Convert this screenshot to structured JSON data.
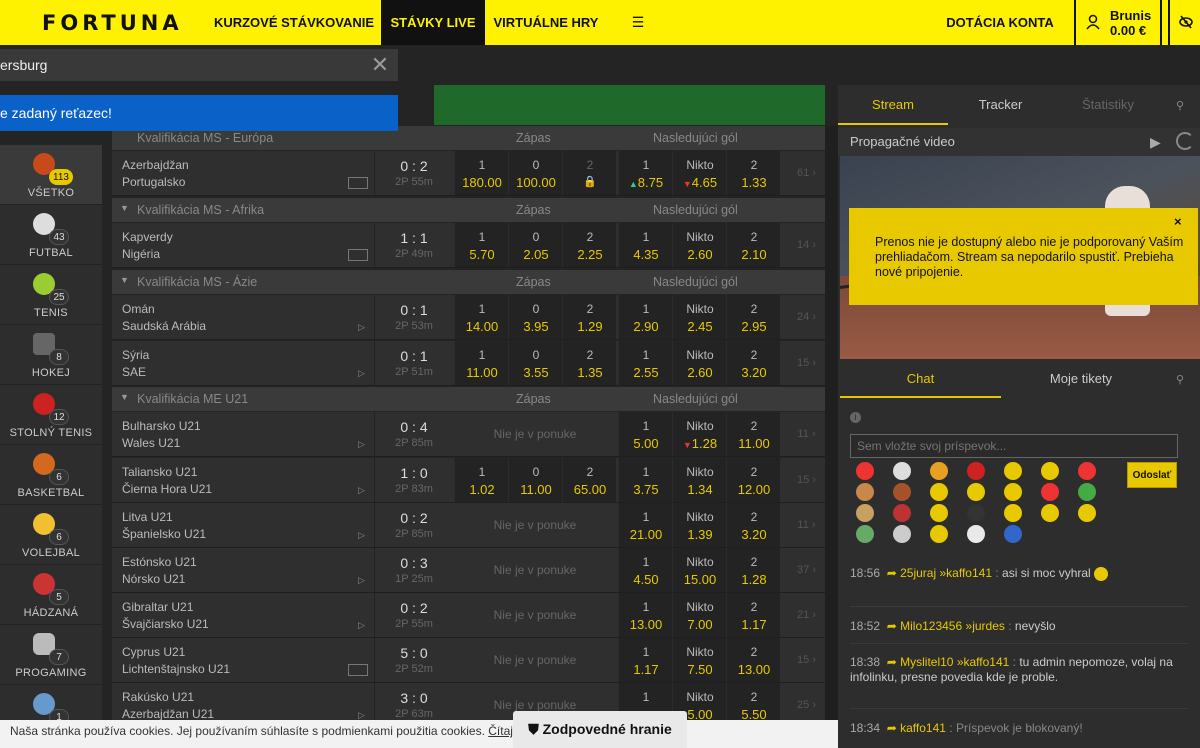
{
  "header": {
    "logo": "FORTUNA",
    "nav": [
      "KURZOVÉ STÁVKOVANIE",
      "STÁVKY LIVE",
      "VIRTUÁLNE HRY"
    ],
    "deposit": "DOTÁCIA KONTA",
    "username": "Brunis",
    "balance": "0.00 €"
  },
  "search": {
    "value": "ersburg",
    "message": "e zadaný reťazec!"
  },
  "sidebar": {
    "items": [
      {
        "label": "VŠETKO",
        "count": "113",
        "color": "#c84a1a"
      },
      {
        "label": "FUTBAL",
        "count": "43",
        "color": "#dddddd"
      },
      {
        "label": "TENIS",
        "count": "25",
        "color": "#9acd32"
      },
      {
        "label": "HOKEJ",
        "count": "8",
        "color": "#666666"
      },
      {
        "label": "STOLNÝ TENIS",
        "count": "12",
        "color": "#cc2222"
      },
      {
        "label": "BASKETBAL",
        "count": "6",
        "color": "#d2691e"
      },
      {
        "label": "VOLEJBAL",
        "count": "6",
        "color": "#f0c030"
      },
      {
        "label": "HÁDZANÁ",
        "count": "5",
        "color": "#cc3333"
      },
      {
        "label": "PROGAMING",
        "count": "7",
        "color": "#bbbbbb"
      },
      {
        "label": "",
        "count": "1",
        "color": "#6699cc"
      }
    ]
  },
  "main": {
    "partial_group": "Kvalifikácia MS - Európa",
    "col_zapas": "Zápas",
    "col_gol": "Nasledujúci gól",
    "na_text": "Nie je v ponuke",
    "groups": [
      {
        "name": "Kvalifikácia MS - Afrika"
      },
      {
        "name": "Kvalifikácia MS - Ázie"
      },
      {
        "name": "Kvalifikácia ME U21"
      }
    ],
    "rows": [
      {
        "t1": "Azerbajdžan",
        "t2": "Portugalsko",
        "score": "0 : 2",
        "time": "2P 55m",
        "l1": "1",
        "v1": "180.00",
        "l0": "0",
        "v0": "100.00",
        "l2": "2",
        "v2": "",
        "g1l": "1",
        "g1": "8.75",
        "gnl": "Nikto",
        "gn": "4.65",
        "g2l": "2",
        "g2": "1.33",
        "more": "61"
      },
      {
        "t1": "Kapverdy",
        "t2": "Nigéria",
        "score": "1 : 1",
        "time": "2P 49m",
        "l1": "1",
        "v1": "5.70",
        "l0": "0",
        "v0": "2.05",
        "l2": "2",
        "v2": "2.25",
        "g1l": "1",
        "g1": "4.35",
        "gnl": "Nikto",
        "gn": "2.60",
        "g2l": "2",
        "g2": "2.10",
        "more": "14"
      },
      {
        "t1": "Omán",
        "t2": "Saudská Arábia",
        "score": "0 : 1",
        "time": "2P 53m",
        "l1": "1",
        "v1": "14.00",
        "l0": "0",
        "v0": "3.95",
        "l2": "2",
        "v2": "1.29",
        "g1l": "1",
        "g1": "2.90",
        "gnl": "Nikto",
        "gn": "2.45",
        "g2l": "2",
        "g2": "2.95",
        "more": "24"
      },
      {
        "t1": "Sýria",
        "t2": "SAE",
        "score": "0 : 1",
        "time": "2P 51m",
        "l1": "1",
        "v1": "11.00",
        "l0": "0",
        "v0": "3.55",
        "l2": "2",
        "v2": "1.35",
        "g1l": "1",
        "g1": "2.55",
        "gnl": "Nikto",
        "gn": "2.60",
        "g2l": "2",
        "g2": "3.20",
        "more": "15"
      },
      {
        "t1": "Bulharsko U21",
        "t2": "Wales U21",
        "score": "0 : 4",
        "time": "2P 85m",
        "g1l": "1",
        "g1": "5.00",
        "gnl": "Nikto",
        "gn": "1.28",
        "g2l": "2",
        "g2": "11.00",
        "more": "11"
      },
      {
        "t1": "Taliansko U21",
        "t2": "Čierna Hora U21",
        "score": "1 : 0",
        "time": "2P 83m",
        "l1": "1",
        "v1": "1.02",
        "l0": "0",
        "v0": "11.00",
        "l2": "2",
        "v2": "65.00",
        "g1l": "1",
        "g1": "3.75",
        "gnl": "Nikto",
        "gn": "1.34",
        "g2l": "2",
        "g2": "12.00",
        "more": "15"
      },
      {
        "t1": "Litva U21",
        "t2": "Španielsko U21",
        "score": "0 : 2",
        "time": "2P 85m",
        "g1l": "1",
        "g1": "21.00",
        "gnl": "Nikto",
        "gn": "1.39",
        "g2l": "2",
        "g2": "3.20",
        "more": "11"
      },
      {
        "t1": "Estónsko U21",
        "t2": "Nórsko U21",
        "score": "0 : 3",
        "time": "1P 25m",
        "g1l": "1",
        "g1": "4.50",
        "gnl": "Nikto",
        "gn": "15.00",
        "g2l": "2",
        "g2": "1.28",
        "more": "37"
      },
      {
        "t1": "Gibraltar U21",
        "t2": "Švajčiarsko U21",
        "score": "0 : 2",
        "time": "2P 55m",
        "g1l": "1",
        "g1": "13.00",
        "gnl": "Nikto",
        "gn": "7.00",
        "g2l": "2",
        "g2": "1.17",
        "more": "21"
      },
      {
        "t1": "Cyprus U21",
        "t2": "Lichtenštajnsko U21",
        "score": "5 : 0",
        "time": "2P 52m",
        "g1l": "1",
        "g1": "1.17",
        "gnl": "Nikto",
        "gn": "7.50",
        "g2l": "2",
        "g2": "13.00",
        "more": "15"
      },
      {
        "t1": "Rakúsko U21",
        "t2": "Azerbajdžan U21",
        "score": "3 : 0",
        "time": "2P 63m",
        "g1l": "1",
        "g1": "",
        "gnl": "Nikto",
        "gn": "5.00",
        "g2l": "2",
        "g2": "5.50",
        "more": "25"
      }
    ]
  },
  "right": {
    "tabs": [
      "Stream",
      "Tracker",
      "Štatistiky"
    ],
    "promo": "Propagačné video",
    "overlay": "Prenos nie je dostupný alebo nie je podporovaný Vaším prehliadačom. Stream sa nepodarilo spustiť. Prebieha nové pripojenie.",
    "chat_tabs": [
      "Chat",
      "Moje tikety"
    ],
    "chat_placeholder": "Sem vložte svoj príspevok...",
    "send": "Odoslať",
    "messages": [
      {
        "time": "18:56",
        "user": "25juraj",
        "to": "kaffo141",
        "text": "asi si moc vyhral"
      },
      {
        "time": "18:52",
        "user": "Milo123456",
        "to": "jurdes",
        "text": "nevyšlo"
      },
      {
        "time": "18:38",
        "user": "Myslitel10",
        "to": "kaffo141",
        "text": "tu admin nepomoze, volaj na infolinku, presne povedia kde je proble."
      },
      {
        "time": "18:34",
        "user": "kaffo141",
        "to": "",
        "text": "Príspevok je blokovaný!"
      }
    ]
  },
  "cookie": {
    "text": "Naša stránka používa cookies. Jej používaním súhlasíte s podmienkami použitia cookies. ",
    "link": "Čítaj"
  },
  "responsible": "Zodpovedné hranie"
}
